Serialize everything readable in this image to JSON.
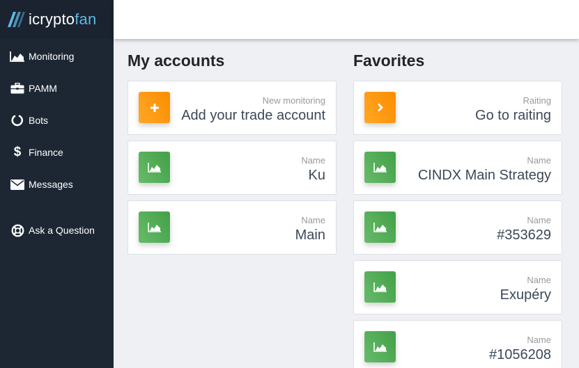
{
  "brand": {
    "name_part1": "icrypto",
    "name_part2": "fan"
  },
  "sidebar": {
    "items": [
      {
        "label": "Monitoring",
        "icon": "area-chart-icon"
      },
      {
        "label": "PAMM",
        "icon": "briefcase-icon"
      },
      {
        "label": "Bots",
        "icon": "spinner-ring-icon"
      },
      {
        "label": "Finance",
        "icon": "dollar-icon"
      },
      {
        "label": "Messages",
        "icon": "envelope-icon"
      },
      {
        "label": "Ask a Question",
        "icon": "lifebuoy-icon"
      }
    ]
  },
  "accounts": {
    "title": "My accounts",
    "cards": [
      {
        "label": "New monitoring",
        "value": "Add your trade account",
        "icon": "plus-icon",
        "color": "#fb8c00"
      },
      {
        "label": "Name",
        "value": "Ku",
        "icon": "area-chart-icon",
        "color": "#4caf50"
      },
      {
        "label": "Name",
        "value": "Main",
        "icon": "area-chart-icon",
        "color": "#4caf50"
      }
    ]
  },
  "favorites": {
    "title": "Favorites",
    "cards": [
      {
        "label": "Raiting",
        "value": "Go to raiting",
        "icon": "chevron-right-icon",
        "color": "#fb8c00"
      },
      {
        "label": "Name",
        "value": "CINDX Main Strategy",
        "icon": "area-chart-icon",
        "color": "#4caf50"
      },
      {
        "label": "Name",
        "value": "#353629",
        "icon": "area-chart-icon",
        "color": "#4caf50"
      },
      {
        "label": "Name",
        "value": "Exupéry",
        "icon": "area-chart-icon",
        "color": "#4caf50"
      },
      {
        "label": "Name",
        "value": "#1056208",
        "icon": "area-chart-icon",
        "color": "#4caf50"
      }
    ]
  }
}
